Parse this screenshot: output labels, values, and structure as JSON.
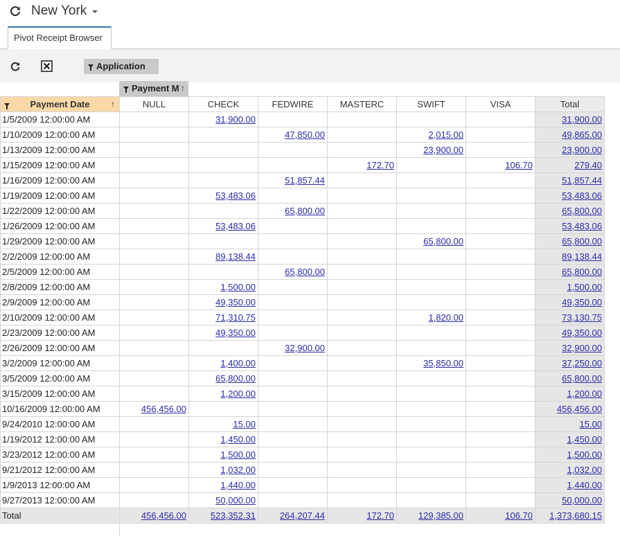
{
  "header": {
    "title": "New York"
  },
  "tabs": [
    {
      "label": "Pivot Receipt Browser"
    }
  ],
  "toolbar": {
    "application_filter": "Application"
  },
  "pivot": {
    "column_group": "Payment M",
    "row_header": "Payment Date",
    "columns": [
      "NULL",
      "CHECK",
      "FEDWIRE",
      "MASTERC",
      "SWIFT",
      "VISA",
      "Total"
    ],
    "rows": [
      {
        "date": "1/5/2009 12:00:00 AM",
        "cells": [
          "",
          "31,900.00",
          "",
          "",
          "",
          "",
          "31,900.00"
        ]
      },
      {
        "date": "1/10/2009 12:00:00 AM",
        "cells": [
          "",
          "",
          "47,850.00",
          "",
          "2,015.00",
          "",
          "49,865.00"
        ]
      },
      {
        "date": "1/13/2009 12:00:00 AM",
        "cells": [
          "",
          "",
          "",
          "",
          "23,900.00",
          "",
          "23,900.00"
        ]
      },
      {
        "date": "1/15/2009 12:00:00 AM",
        "cells": [
          "",
          "",
          "",
          "172.70",
          "",
          "106.70",
          "279.40"
        ]
      },
      {
        "date": "1/16/2009 12:00:00 AM",
        "cells": [
          "",
          "",
          "51,857.44",
          "",
          "",
          "",
          "51,857.44"
        ]
      },
      {
        "date": "1/19/2009 12:00:00 AM",
        "cells": [
          "",
          "53,483.06",
          "",
          "",
          "",
          "",
          "53,483.06"
        ]
      },
      {
        "date": "1/22/2009 12:00:00 AM",
        "cells": [
          "",
          "",
          "65,800.00",
          "",
          "",
          "",
          "65,800.00"
        ]
      },
      {
        "date": "1/26/2009 12:00:00 AM",
        "cells": [
          "",
          "53,483.06",
          "",
          "",
          "",
          "",
          "53,483.06"
        ]
      },
      {
        "date": "1/29/2009 12:00:00 AM",
        "cells": [
          "",
          "",
          "",
          "",
          "65,800.00",
          "",
          "65,800.00"
        ]
      },
      {
        "date": "2/2/2009 12:00:00 AM",
        "cells": [
          "",
          "89,138.44",
          "",
          "",
          "",
          "",
          "89,138.44"
        ]
      },
      {
        "date": "2/5/2009 12:00:00 AM",
        "cells": [
          "",
          "",
          "65,800.00",
          "",
          "",
          "",
          "65,800.00"
        ]
      },
      {
        "date": "2/8/2009 12:00:00 AM",
        "cells": [
          "",
          "1,500.00",
          "",
          "",
          "",
          "",
          "1,500.00"
        ]
      },
      {
        "date": "2/9/2009 12:00:00 AM",
        "cells": [
          "",
          "49,350.00",
          "",
          "",
          "",
          "",
          "49,350.00"
        ]
      },
      {
        "date": "2/10/2009 12:00:00 AM",
        "cells": [
          "",
          "71,310.75",
          "",
          "",
          "1,820.00",
          "",
          "73,130.75"
        ]
      },
      {
        "date": "2/23/2009 12:00:00 AM",
        "cells": [
          "",
          "49,350.00",
          "",
          "",
          "",
          "",
          "49,350.00"
        ]
      },
      {
        "date": "2/26/2009 12:00:00 AM",
        "cells": [
          "",
          "",
          "32,900.00",
          "",
          "",
          "",
          "32,900.00"
        ]
      },
      {
        "date": "3/2/2009 12:00:00 AM",
        "cells": [
          "",
          "1,400.00",
          "",
          "",
          "35,850.00",
          "",
          "37,250.00"
        ]
      },
      {
        "date": "3/5/2009 12:00:00 AM",
        "cells": [
          "",
          "65,800.00",
          "",
          "",
          "",
          "",
          "65,800.00"
        ]
      },
      {
        "date": "3/15/2009 12:00:00 AM",
        "cells": [
          "",
          "1,200.00",
          "",
          "",
          "",
          "",
          "1,200.00"
        ]
      },
      {
        "date": "10/16/2009 12:00:00 AM",
        "cells": [
          "456,456.00",
          "",
          "",
          "",
          "",
          "",
          "456,456.00"
        ]
      },
      {
        "date": "9/24/2010 12:00:00 AM",
        "cells": [
          "",
          "15.00",
          "",
          "",
          "",
          "",
          "15.00"
        ]
      },
      {
        "date": "1/19/2012 12:00:00 AM",
        "cells": [
          "",
          "1,450.00",
          "",
          "",
          "",
          "",
          "1,450.00"
        ]
      },
      {
        "date": "3/23/2012 12:00:00 AM",
        "cells": [
          "",
          "1,500.00",
          "",
          "",
          "",
          "",
          "1,500.00"
        ]
      },
      {
        "date": "9/21/2012 12:00:00 AM",
        "cells": [
          "",
          "1,032.00",
          "",
          "",
          "",
          "",
          "1,032.00"
        ]
      },
      {
        "date": "1/9/2013 12:00:00 AM",
        "cells": [
          "",
          "1,440.00",
          "",
          "",
          "",
          "",
          "1,440.00"
        ]
      },
      {
        "date": "9/27/2013 12:00:00 AM",
        "cells": [
          "",
          "50,000.00",
          "",
          "",
          "",
          "",
          "50,000.00"
        ]
      }
    ],
    "total_row": {
      "label": "Total",
      "cells": [
        "456,456.00",
        "523,352.31",
        "264,207.44",
        "172.70",
        "129,385.00",
        "106.70",
        "1,373,680.15"
      ]
    }
  }
}
